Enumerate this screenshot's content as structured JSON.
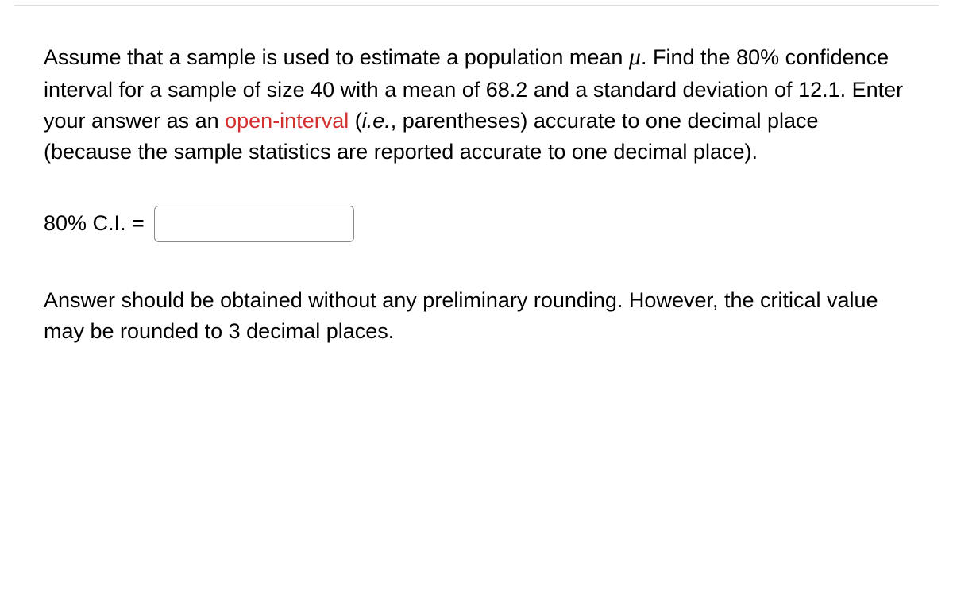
{
  "question": {
    "p1a": "Assume that a sample is used to estimate a population mean ",
    "mu": "μ",
    "p1b": ". Find the 80% confidence interval for a sample of size 40 with a mean of 68.2 and a standard deviation of 12.1. Enter your answer as an ",
    "highlight": "open-interval",
    "p1c": " (",
    "italic": "i.e.",
    "p1d": ", parentheses) accurate to one decimal place (because the sample statistics are reported accurate to one decimal place)."
  },
  "answer": {
    "label": "80% C.I. = ",
    "value": ""
  },
  "note": "Answer should be obtained without any preliminary rounding. However, the critical value may be rounded to 3 decimal places."
}
